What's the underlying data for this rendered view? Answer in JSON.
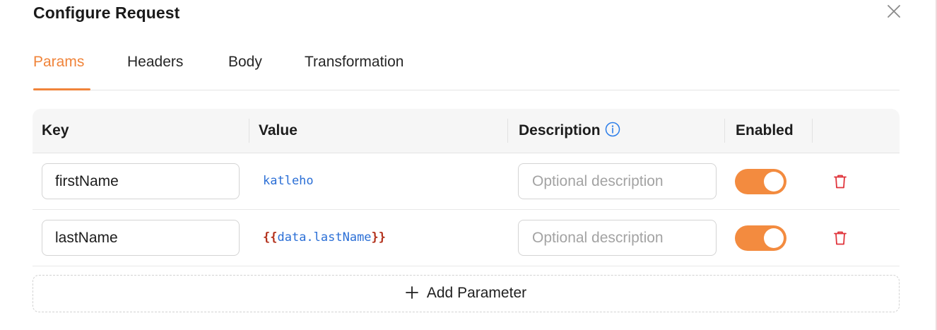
{
  "dialog": {
    "title": "Configure Request"
  },
  "tabs": [
    {
      "label": "Params",
      "active": true
    },
    {
      "label": "Headers",
      "active": false
    },
    {
      "label": "Body",
      "active": false
    },
    {
      "label": "Transformation",
      "active": false
    }
  ],
  "table": {
    "columns": {
      "key": "Key",
      "value": "Value",
      "description": "Description",
      "enabled": "Enabled"
    },
    "rows": [
      {
        "key": "firstName",
        "value": "katleho",
        "description_placeholder": "Optional description",
        "enabled": true
      },
      {
        "key": "lastName",
        "value_open": "{{",
        "value_var": "data.lastName",
        "value_close": "}}",
        "description_placeholder": "Optional description",
        "enabled": true
      }
    ]
  },
  "add_parameter": {
    "label": "Add Parameter"
  },
  "colors": {
    "accent": "#f0843a",
    "toggle_on": "#f38b3f",
    "value_text": "#2b6fd6",
    "template_brace": "#b3321d",
    "delete_icon": "#e0343b"
  },
  "icons": {
    "close": "close-icon",
    "info": "info-icon",
    "delete": "trash-icon",
    "add": "plus-icon"
  }
}
